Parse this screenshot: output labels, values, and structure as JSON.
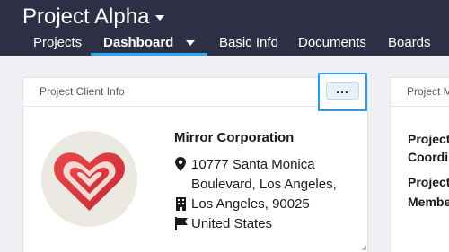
{
  "header": {
    "project_title": "Project Alpha",
    "tabs": [
      {
        "label": "Projects"
      },
      {
        "label": "Dashboard"
      },
      {
        "label": "Basic Info"
      },
      {
        "label": "Documents"
      },
      {
        "label": "Boards"
      }
    ]
  },
  "client_card": {
    "title": "Project Client Info",
    "menu_label": "...",
    "company": "Mirror Corporation",
    "address_line1": "10777 Santa Monica",
    "address_line2": "Boulevard, Los Angeles,",
    "city": "Los Angeles, 90025",
    "country": "United States"
  },
  "second_card": {
    "title": "Project M",
    "line1": "Project",
    "line2": "Coordin",
    "line3": "Project",
    "line4": "Membe"
  },
  "colors": {
    "topbar": "#2d2f45",
    "active_tab_underline": "#2aa6f2",
    "focus_ring": "#2b9be8",
    "logo_red": "#d8333a"
  }
}
